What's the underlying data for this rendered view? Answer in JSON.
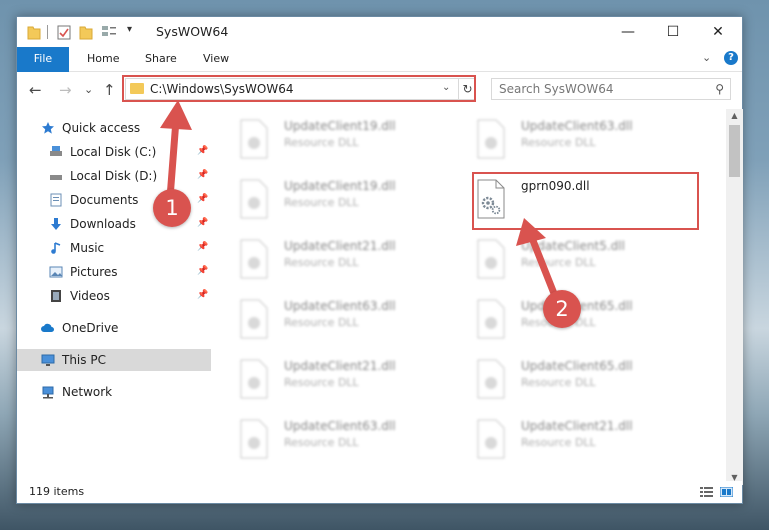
{
  "window": {
    "title": "SysWOW64",
    "controls": {
      "minimize": "—",
      "maximize": "☐",
      "close": "✕"
    }
  },
  "ribbon": {
    "tabs": [
      "File",
      "Home",
      "Share",
      "View"
    ],
    "collapse_glyph": "⌄",
    "help_glyph": "?"
  },
  "nav_buttons": {
    "back": "←",
    "forward": "→",
    "recent": "⌄",
    "up": "↑"
  },
  "address": {
    "path": "C:\\Windows\\SysWOW64",
    "dropdown_glyph": "⌄",
    "refresh_glyph": "↻"
  },
  "search": {
    "placeholder": "Search SysWOW64",
    "icon_glyph": "⚲"
  },
  "sidebar": {
    "items": [
      {
        "label": "Quick access",
        "icon": "star-icon"
      },
      {
        "label": "Local Disk (C:)",
        "icon": "drive-icon",
        "pinned": true
      },
      {
        "label": "Local Disk (D:)",
        "icon": "drive-icon",
        "pinned": true
      },
      {
        "label": "Documents",
        "icon": "documents-icon",
        "pinned": true
      },
      {
        "label": "Downloads",
        "icon": "download-icon",
        "pinned": true
      },
      {
        "label": "Music",
        "icon": "music-icon",
        "pinned": true
      },
      {
        "label": "Pictures",
        "icon": "pictures-icon",
        "pinned": true
      },
      {
        "label": "Videos",
        "icon": "videos-icon",
        "pinned": true
      },
      {
        "label": "OneDrive",
        "icon": "cloud-icon"
      },
      {
        "label": "This PC",
        "icon": "monitor-icon",
        "selected": true
      },
      {
        "label": "Network",
        "icon": "network-icon"
      }
    ],
    "pin_glyph": "📌"
  },
  "files": {
    "left": [
      {
        "name": "UpdateClient19.dll",
        "type": "Resource DLL"
      },
      {
        "name": "UpdateClient19.dll",
        "type": "Resource DLL"
      },
      {
        "name": "UpdateClient21.dll",
        "type": "Resource DLL"
      },
      {
        "name": "UpdateClient63.dll",
        "type": "Resource DLL"
      },
      {
        "name": "UpdateClient21.dll",
        "type": "Resource DLL"
      },
      {
        "name": "UpdateClient63.dll",
        "type": "Resource DLL"
      }
    ],
    "right": [
      {
        "name": "UpdateClient63.dll",
        "type": "Resource DLL"
      },
      {
        "name": "gprn090.dll",
        "type": "",
        "highlighted": true
      },
      {
        "name": "UpdateClient5.dll",
        "type": "Resource DLL"
      },
      {
        "name": "UpdateClient65.dll",
        "type": "Resource DLL"
      },
      {
        "name": "UpdateClient65.dll",
        "type": "Resource DLL"
      },
      {
        "name": "UpdateClient21.dll",
        "type": "Resource DLL"
      }
    ]
  },
  "status": {
    "item_count": "119 items"
  },
  "annotations": {
    "step1": "1",
    "step2": "2"
  },
  "colors": {
    "accent": "#1979ca",
    "annotation": "#d9534f",
    "folder": "#f3c959"
  }
}
